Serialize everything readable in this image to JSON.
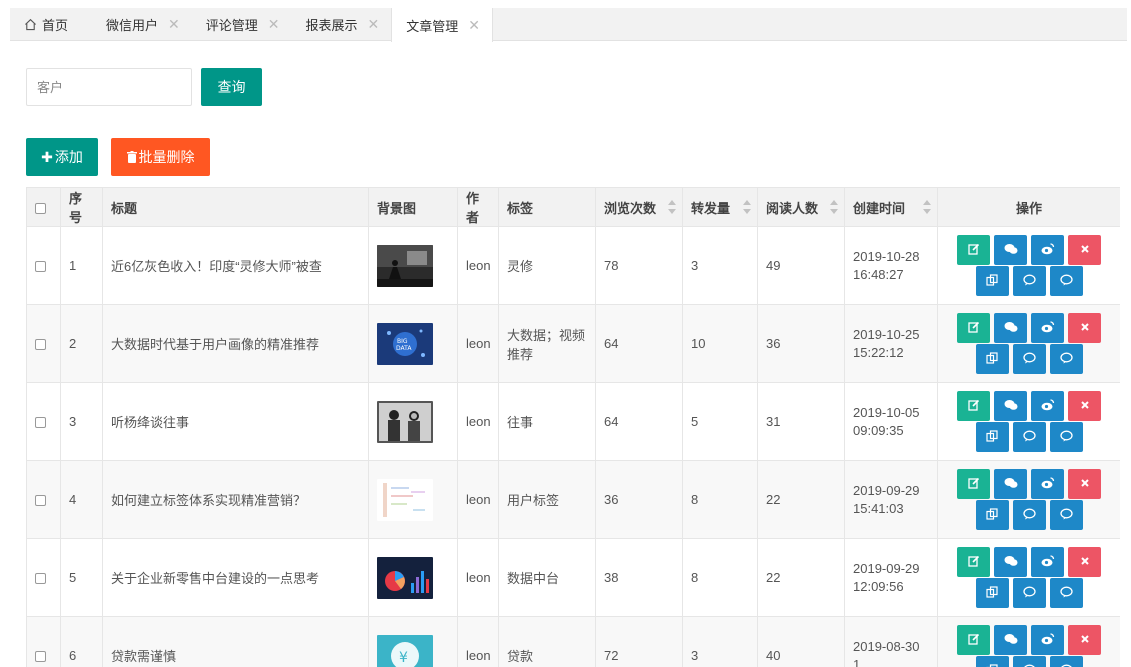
{
  "tabs": [
    {
      "label": "首页",
      "closable": false,
      "active": false,
      "icon": "home-icon"
    },
    {
      "label": "微信用户",
      "closable": true,
      "active": false
    },
    {
      "label": "评论管理",
      "closable": true,
      "active": false
    },
    {
      "label": "报表展示",
      "closable": true,
      "active": false
    },
    {
      "label": "文章管理",
      "closable": true,
      "active": true
    }
  ],
  "search": {
    "placeholder": "客户",
    "value": "",
    "button_label": "查询"
  },
  "toolbar": {
    "add_label": "添加",
    "batch_delete_label": "批量删除"
  },
  "colors": {
    "teal": "#009688",
    "orange": "#ff5722",
    "green_op": "#1ab394",
    "blue_op": "#1e88c8",
    "red_op": "#ed5565"
  },
  "table": {
    "headers": [
      "序号",
      "标题",
      "背景图",
      "作者",
      "标签",
      "浏览次数",
      "转发量",
      "阅读人数",
      "创建时间",
      "操作"
    ],
    "sortable": [
      "浏览次数",
      "转发量",
      "阅读人数",
      "创建时间"
    ],
    "rows": [
      {
        "no": "1",
        "title": "近6亿灰色收入！印度“灵修大师”被查",
        "author": "leon",
        "tag": "灵修",
        "views": "78",
        "shares": "3",
        "readers": "49",
        "created": "2019-10-28 16:48:27",
        "thumb": "meditation-silhouette"
      },
      {
        "no": "2",
        "title": "大数据时代基于用户画像的精准推荐",
        "author": "leon",
        "tag": "大数据；视频推荐",
        "views": "64",
        "shares": "10",
        "readers": "36",
        "created": "2019-10-25 15:22:12",
        "thumb": "big-data-blue"
      },
      {
        "no": "3",
        "title": "听杨绛谈往事",
        "author": "leon",
        "tag": "往事",
        "views": "64",
        "shares": "5",
        "readers": "31",
        "created": "2019-10-05 09:09:35",
        "thumb": "old-photo"
      },
      {
        "no": "4",
        "title": "如何建立标签体系实现精准营销？",
        "author": "leon",
        "tag": "用户标签",
        "views": "36",
        "shares": "8",
        "readers": "22",
        "created": "2019-09-29 15:41:03",
        "thumb": "tag-diagram"
      },
      {
        "no": "5",
        "title": "关于企业新零售中台建设的一点思考",
        "author": "leon",
        "tag": "数据中台",
        "views": "38",
        "shares": "8",
        "readers": "22",
        "created": "2019-09-29 12:09:56",
        "thumb": "dashboard-chart"
      },
      {
        "no": "6",
        "title": "贷款需谨慎",
        "author": "leon",
        "tag": "贷款",
        "views": "72",
        "shares": "3",
        "readers": "40",
        "created": "2019-08-30 1",
        "thumb": "yen-icon"
      }
    ],
    "row_actions": [
      "edit-icon",
      "wechat-icon",
      "weibo-icon",
      "delete-icon",
      "copy-icon",
      "comment-icon",
      "comment-alt-icon"
    ]
  }
}
